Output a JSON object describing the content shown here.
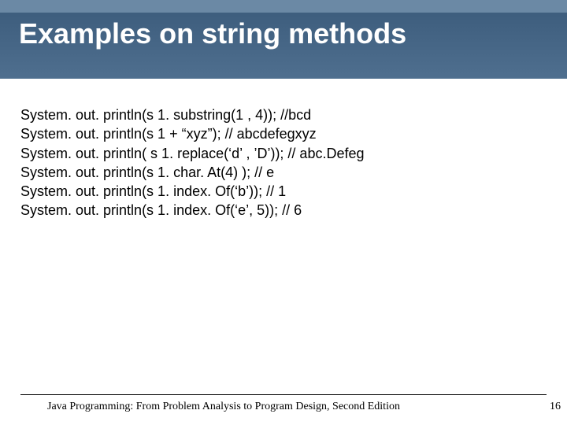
{
  "slide": {
    "title": "Examples on string methods",
    "lines": [
      "System. out. println(s 1. substring(1 , 4)); //bcd",
      "System. out. println(s 1 + “xyz”); // abcdefegxyz",
      "System. out. println( s 1. replace(‘d’ , ’D’)); // abc.Defeg",
      "System. out. println(s 1. char. At(4) );  // e",
      "System. out. println(s 1. index. Of(‘b’));  // 1",
      "System. out. println(s 1. index. Of(‘e’, 5));  // 6"
    ],
    "footer": "Java Programming: From Problem Analysis to Program Design, Second Edition",
    "page": "16"
  }
}
